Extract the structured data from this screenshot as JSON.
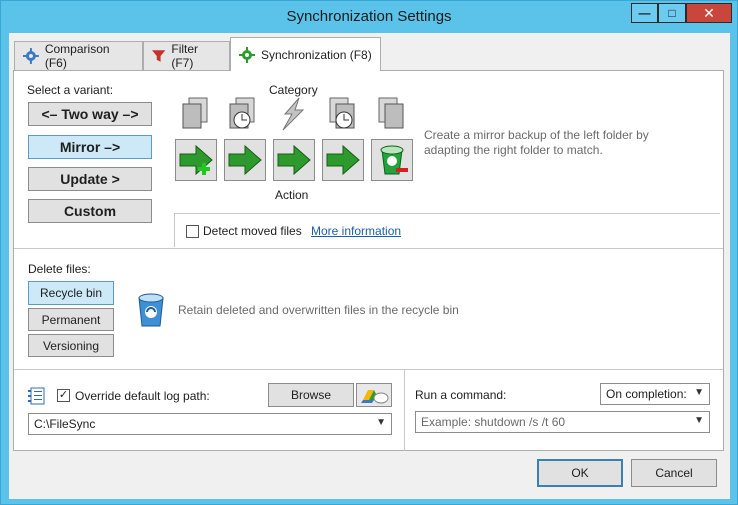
{
  "window": {
    "title": "Synchronization Settings"
  },
  "titlebar_buttons": {
    "minimize": "—",
    "maximize": "□",
    "close": "✕"
  },
  "tabs": [
    {
      "label": "Comparison (F6)",
      "icon": "gear-icon"
    },
    {
      "label": "Filter (F7)",
      "icon": "funnel-icon"
    },
    {
      "label": "Synchronization (F8)",
      "icon": "gear-icon",
      "active": true
    }
  ],
  "variant": {
    "label": "Select a variant:",
    "options": [
      "<– Two way –>",
      "Mirror –>",
      "Update >",
      "Custom"
    ],
    "selected": "Mirror –>"
  },
  "category": {
    "label": "Category"
  },
  "action": {
    "label": "Action"
  },
  "description": "Create a mirror backup of the left folder by adapting the right folder to match.",
  "detect_moved": {
    "label": "Detect moved files",
    "checked": false,
    "link": "More information"
  },
  "delete_files": {
    "label": "Delete files:",
    "options": [
      "Recycle bin",
      "Permanent",
      "Versioning"
    ],
    "selected": "Recycle bin",
    "description": "Retain deleted and overwritten files in the recycle bin"
  },
  "log": {
    "override_label": "Override default log path:",
    "override_checked": true,
    "browse_label": "Browse",
    "path_value": "C:\\FileSync"
  },
  "command": {
    "label": "Run a command:",
    "when": "On completion:",
    "placeholder": "Example: shutdown /s /t 60"
  },
  "footer": {
    "ok": "OK",
    "cancel": "Cancel"
  },
  "colors": {
    "titlebar": "#5bc3ea",
    "selected": "#cde8f7",
    "arrow_green": "#2e9a2e",
    "link": "#1c5fa8"
  }
}
